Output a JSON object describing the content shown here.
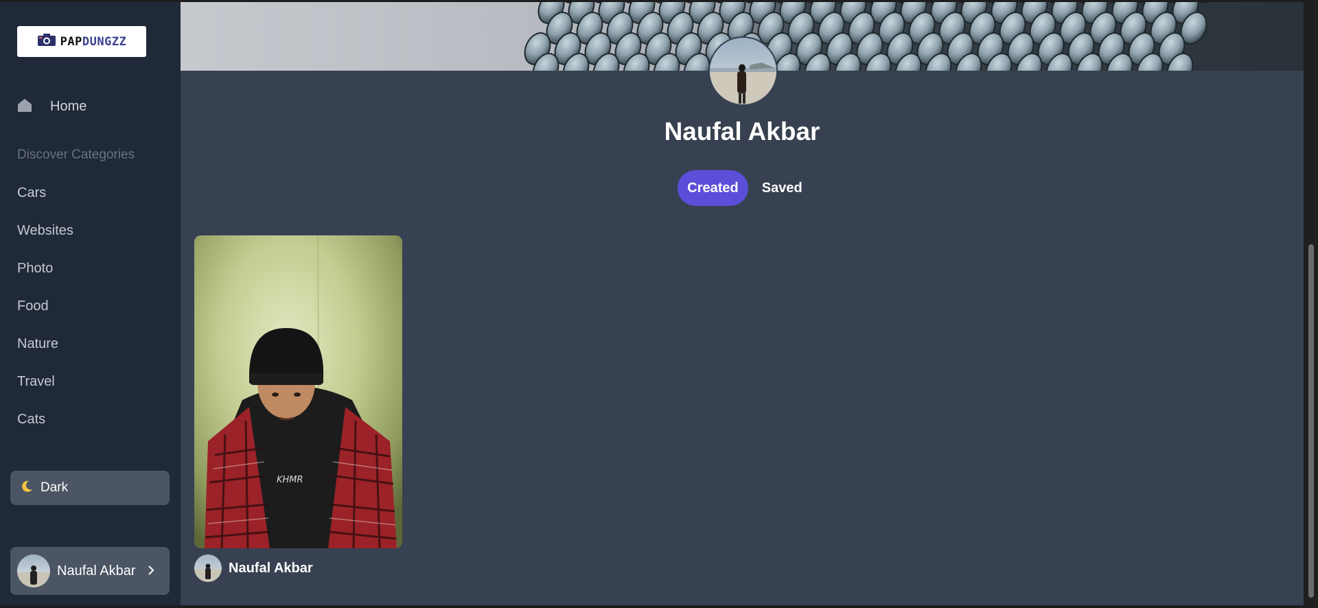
{
  "sidebar": {
    "logo": {
      "part1": "PAP",
      "part2": "DUNGZZ",
      "icon": "camera-icon"
    },
    "home": {
      "label": "Home",
      "icon": "home-icon"
    },
    "section_title": "Discover Categories",
    "categories": [
      "Cars",
      "Websites",
      "Photo",
      "Food",
      "Nature",
      "Travel",
      "Cats"
    ],
    "theme_toggle": {
      "label": "Dark",
      "icon": "moon-icon"
    },
    "user": {
      "name": "Naufal Akbar",
      "icon": "chevron-right-icon"
    }
  },
  "profile": {
    "name": "Naufal Akbar",
    "tabs": [
      {
        "label": "Created",
        "active": true
      },
      {
        "label": "Saved",
        "active": false
      }
    ]
  },
  "pins": [
    {
      "author": "Naufal Akbar"
    }
  ],
  "colors": {
    "sidebar_bg": "#1f2937",
    "main_bg": "#374151",
    "accent": "#5b4fd9",
    "button_bg": "#4b5563"
  }
}
